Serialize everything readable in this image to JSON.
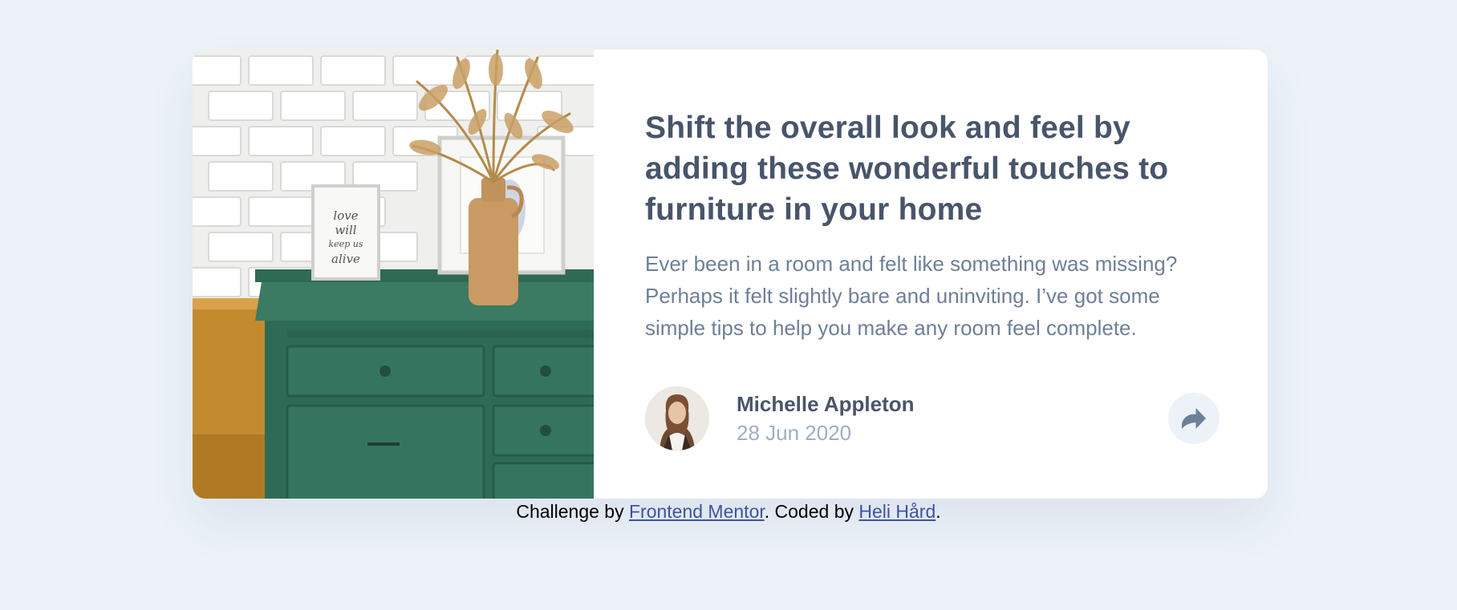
{
  "article": {
    "image_alt": "Green drawers with frames and a vase",
    "frame_text": "love will keep us alive",
    "title": "Shift the overall look and feel by adding these wonderful touches to furniture in your home",
    "description": "Ever been in a room and felt like something was missing? Perhaps it felt slightly bare and uninviting. I’ve got some simple tips to help you make any room feel complete.",
    "author": {
      "name": "Michelle Appleton",
      "date": "28 Jun 2020",
      "avatar_icon": "avatar-photo"
    },
    "share_icon": "share-icon"
  },
  "attribution": {
    "prefix": "Challenge by ",
    "link1": "Frontend Mentor",
    "middle": ". Coded by ",
    "link2": "Heli Hård",
    "suffix": "."
  },
  "colors": {
    "background": "#ecf2f8",
    "title": "#48556a",
    "body": "#6e8098",
    "muted": "#9eafc2",
    "link": "#3e52a3"
  }
}
